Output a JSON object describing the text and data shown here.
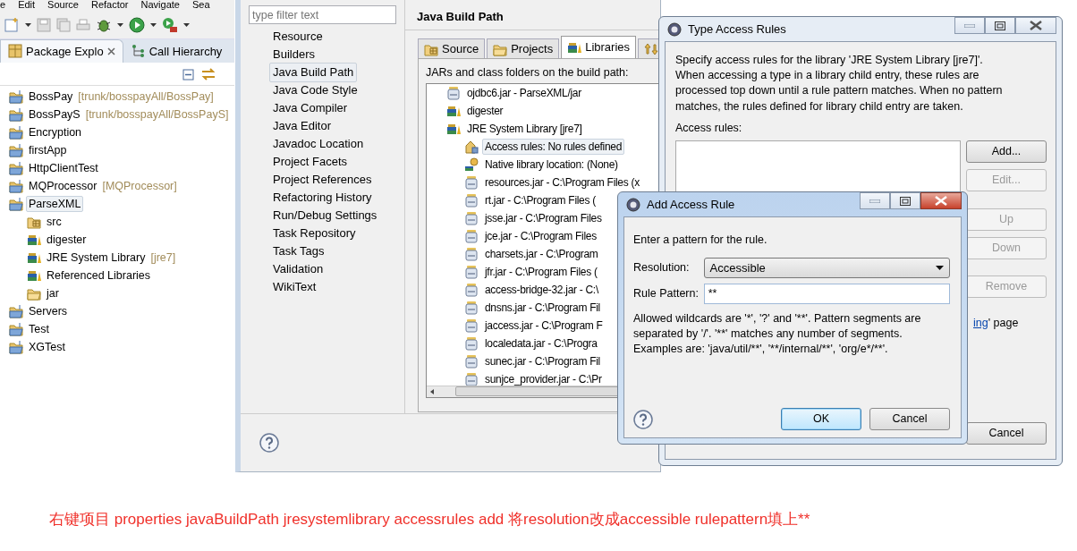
{
  "menu": [
    {
      "label": "e"
    },
    {
      "label": "Edit"
    },
    {
      "label": "Source"
    },
    {
      "label": "Refactor"
    },
    {
      "label": "Navigate"
    },
    {
      "label": "Sea"
    }
  ],
  "views": [
    {
      "label": "Package Explo",
      "selected": true,
      "kind": "packages"
    },
    {
      "label": "Call Hierarchy",
      "selected": false,
      "kind": "calls"
    }
  ],
  "package_explorer": [
    {
      "label": "BossPay",
      "decoration": "[trunk/bosspayAll/BossPay]",
      "kind": "project",
      "selected": false
    },
    {
      "label": "BossPayS",
      "decoration": "[trunk/bosspayAll/BossPayS]",
      "kind": "project",
      "selected": false
    },
    {
      "label": "Encryption",
      "kind": "project",
      "selected": false
    },
    {
      "label": "firstApp",
      "kind": "project",
      "selected": false
    },
    {
      "label": "HttpClientTest",
      "kind": "project",
      "selected": false
    },
    {
      "label": "MQProcessor",
      "decoration": "[MQProcessor]",
      "kind": "project",
      "selected": false
    },
    {
      "label": "ParseXML",
      "kind": "project",
      "selected": true,
      "children": [
        {
          "label": "src",
          "kind": "source",
          "selected": false
        },
        {
          "label": "digester",
          "kind": "library",
          "selected": false
        },
        {
          "label": "JRE System Library",
          "decoration": "[jre7]",
          "kind": "library",
          "selected": false
        },
        {
          "label": "Referenced Libraries",
          "kind": "library",
          "selected": false
        },
        {
          "label": "jar",
          "kind": "folder",
          "selected": false
        }
      ]
    },
    {
      "label": "Servers",
      "kind": "project",
      "selected": false
    },
    {
      "label": "Test",
      "kind": "project",
      "selected": false
    },
    {
      "label": "XGTest",
      "kind": "project",
      "selected": false
    }
  ],
  "properties": {
    "filter": {
      "placeholder": "type filter text"
    },
    "pages": [
      {
        "label": "Resource",
        "selected": false
      },
      {
        "label": "Builders",
        "selected": false
      },
      {
        "label": "Java Build Path",
        "selected": true
      },
      {
        "label": "Java Code Style",
        "selected": false
      },
      {
        "label": "Java Compiler",
        "selected": false
      },
      {
        "label": "Java Editor",
        "selected": false
      },
      {
        "label": "Javadoc Location",
        "selected": false
      },
      {
        "label": "Project Facets",
        "selected": false
      },
      {
        "label": "Project References",
        "selected": false
      },
      {
        "label": "Refactoring History",
        "selected": false
      },
      {
        "label": "Run/Debug Settings",
        "selected": false
      },
      {
        "label": "Task Repository",
        "selected": false
      },
      {
        "label": "Task Tags",
        "selected": false
      },
      {
        "label": "Validation",
        "selected": false
      },
      {
        "label": "WikiText",
        "selected": false
      }
    ],
    "page_title": "Java Build Path",
    "tabs": [
      {
        "label": "Source",
        "kind": "source",
        "selected": false
      },
      {
        "label": "Projects",
        "kind": "folder",
        "selected": false
      },
      {
        "label": "Libraries",
        "kind": "library",
        "selected": true
      },
      {
        "kind": "order",
        "selected": false
      }
    ],
    "list_label": "JARs and class folders on the build path:",
    "libraries": [
      {
        "label": "ojdbc6.jar - ParseXML/jar",
        "kind": "jar",
        "selected": false
      },
      {
        "label": "digester",
        "kind": "library",
        "selected": false
      },
      {
        "label": "JRE System Library [jre7]",
        "kind": "library",
        "selected": false,
        "children": [
          {
            "label": "Access rules: No rules defined",
            "kind": "rules",
            "selected": true
          },
          {
            "label": "Native library location: (None)",
            "kind": "native",
            "selected": false
          },
          {
            "label": "resources.jar - C:\\Program Files (x",
            "kind": "jar",
            "selected": false
          },
          {
            "label": "rt.jar - C:\\Program Files (",
            "kind": "jar",
            "selected": false
          },
          {
            "label": "jsse.jar - C:\\Program Files",
            "kind": "jar",
            "selected": false
          },
          {
            "label": "jce.jar - C:\\Program Files",
            "kind": "jar",
            "selected": false
          },
          {
            "label": "charsets.jar - C:\\Program",
            "kind": "jar",
            "selected": false
          },
          {
            "label": "jfr.jar - C:\\Program Files (",
            "kind": "jar",
            "selected": false
          },
          {
            "label": "access-bridge-32.jar - C:\\",
            "kind": "jar",
            "selected": false
          },
          {
            "label": "dnsns.jar - C:\\Program Fil",
            "kind": "jar",
            "selected": false
          },
          {
            "label": "jaccess.jar - C:\\Program F",
            "kind": "jar",
            "selected": false
          },
          {
            "label": "localedata.jar - C:\\Progra",
            "kind": "jar",
            "selected": false
          },
          {
            "label": "sunec.jar - C:\\Program Fil",
            "kind": "jar",
            "selected": false
          },
          {
            "label": "sunjce_provider.jar - C:\\Pr",
            "kind": "jar",
            "selected": false
          }
        ]
      }
    ]
  },
  "type_access_rules": {
    "title": "Type Access Rules",
    "description": "Specify access rules for the library 'JRE System Library [jre7]'.\nWhen accessing a type in a library child entry, these rules are\nprocessed top down until a rule pattern matches. When no pattern\nmatches, the rules defined for library child entry are taken.",
    "list_label": "Access rules:",
    "buttons": [
      {
        "label": "Add...",
        "disabled": false
      },
      {
        "label": "Edit...",
        "disabled": true
      },
      {
        "label": "Up",
        "disabled": true
      },
      {
        "label": "Down",
        "disabled": true
      },
      {
        "label": "Remove",
        "disabled": true
      }
    ],
    "link": "ing",
    "link_suffix": "' page",
    "cancel": "Cancel"
  },
  "add_access_rule": {
    "title": "Add Access Rule",
    "prompt": "Enter a pattern for the rule.",
    "resolution": {
      "label": "Resolution:",
      "value": "Accessible"
    },
    "pattern": {
      "label": "Rule Pattern:",
      "value": "**"
    },
    "help": "Allowed wildcards are '*', '?' and '**'. Pattern segments are\nseparated by '/'. '**' matches any number of segments.\nExamples are: 'java/util/**', '**/internal/**', 'org/e*/**'.",
    "buttons": [
      {
        "label": "OK",
        "kind": "default"
      },
      {
        "label": "Cancel",
        "kind": "normal"
      }
    ]
  },
  "caption": "右键项目 properties javaBuildPath jresystemlibrary accessrules add 将resolution改成accessible rulepattern填上**"
}
